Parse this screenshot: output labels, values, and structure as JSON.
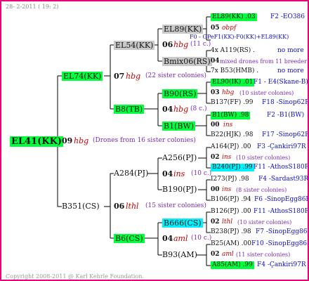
{
  "header": {
    "date": "28- 2-2011 ( 19: 2)"
  },
  "footer": {
    "copyright": "Copyright 2008-2011 @ Karl Kehrle Foundation."
  },
  "root": {
    "id": "EL41(KK)"
  },
  "gen1": {
    "upper": {
      "id": "EL74(KK)"
    },
    "lower": {
      "id": "B351(CS)"
    },
    "drones": {
      "num": "09",
      "line": "hbg",
      "text": "(Drones from 16 sister colonies)"
    }
  },
  "gen2": {
    "a": {
      "id": "EL54(KK)"
    },
    "b": {
      "id": "B8(TB)"
    },
    "c": {
      "id": "A284(PJ)"
    },
    "d": {
      "id": "B6(CS)"
    },
    "upper_num": "07",
    "upper_line": "hbg",
    "upper_text": "(22 sister colonies)",
    "lower_num": "06",
    "lower_line": "lthl",
    "lower_text": "(15 sister colonies)"
  },
  "gen3": {
    "a1": {
      "id": "EL89(KK)"
    },
    "a2": {
      "id": "Bmix06(RS)"
    },
    "b1": {
      "id": "B90(RS)"
    },
    "b2": {
      "id": "B1(BW)"
    },
    "c1": {
      "id": "A256(PJ)"
    },
    "c2": {
      "id": "B190(PJ)"
    },
    "d1": {
      "id": "B666(CS)"
    },
    "d2": {
      "id": "B93(AM)"
    },
    "a_num": "06",
    "a_line": "hbg",
    "a_text": "(11 c.)",
    "b_num": "04",
    "b_line": "hbg",
    "b_text": "(8 c.)",
    "c_num": "04",
    "c_line": "ins",
    "c_text": "(10 c.)",
    "d_num": "04",
    "d_line": "aml",
    "d_text": "(10 c.)"
  },
  "gen4": {
    "r1": {
      "id": "EL89(KK) .03",
      "right": "F2 -EO386"
    },
    "r2": {
      "num": "05",
      "line": "obpf",
      "overlay": "F0 - GPeF1(KK)-F0(KK)+EL89(KK)"
    },
    "r3": {
      "id": "4x A119(RS) .",
      "right": "no more"
    },
    "r4": {
      "num": "04",
      "text": "mixed drones from 11 breeder col."
    },
    "r5": {
      "id": "7x B53(HMB) .",
      "right": "no more"
    },
    "r6": {
      "id": "EL90(IK) .01",
      "right": "F1 - E4(Skane-B)"
    },
    "r7": {
      "num": "03",
      "line": "hbg",
      "text": "(10 sister colonies)"
    },
    "r8": {
      "id": "B137(FF) .99",
      "right": "F18 -Sinop62R"
    },
    "r9": {
      "id": "B1(BW) .98",
      "right": "F2 -B1(BW)"
    },
    "r10": {
      "num": "00",
      "line": "ins"
    },
    "r11": {
      "id": "B22(HJK) .98",
      "right": "F17 -Sinop62R"
    },
    "r12": {
      "id": "A164(PJ) .00",
      "right": "F3 -Çankiri97R"
    },
    "r13": {
      "num": "02",
      "line": "ins",
      "text": "(10 sister colonies)"
    },
    "r14": {
      "id": "B240(PJ) .99",
      "right": "F11 -AthosS180R"
    },
    "r15": {
      "id": "I273(PJ) .98",
      "right": "F4 -Sardast93R"
    },
    "r16": {
      "num": "00",
      "line": "ins",
      "text": "(8 sister colonies)"
    },
    "r17": {
      "id": "B106(PJ) .94",
      "right": "F6 -SinopEgg86R"
    },
    "r18": {
      "id": "B126(PJ) .00",
      "right": "F11 -AthosS180R"
    },
    "r19": {
      "num": "02",
      "line": "lthl",
      "text": "(10 sister colonies)"
    },
    "r20": {
      "id": "B238(PJ) .98",
      "right": "F7 -SinopEgg86R"
    },
    "r21": {
      "id": "B25(AM) .00",
      "right": "F10 -SinopEgg86R"
    },
    "r22": {
      "num": "02",
      "line": "aml",
      "text": "(11 sister colonies)"
    },
    "r23": {
      "id": "A85(AM) .99",
      "right": "F4 -Çankiri97R"
    }
  }
}
